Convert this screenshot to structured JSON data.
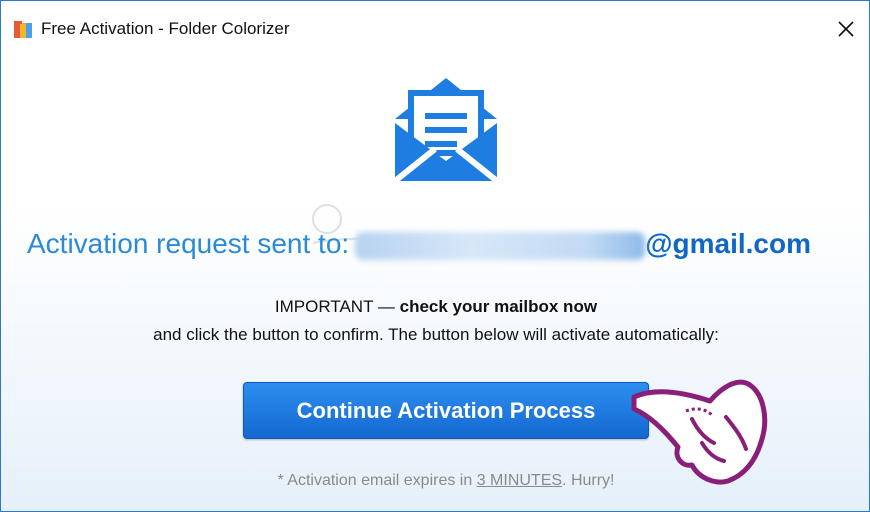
{
  "window": {
    "title": "Free Activation - Folder Colorizer",
    "close_icon": "close-icon"
  },
  "main": {
    "envelope_icon": "envelope-open-icon",
    "headline_prefix": "Activation request sent to:",
    "headline_domain": "@gmail.com",
    "important_prefix": "IMPORTANT — ",
    "important_bold": "check your mailbox now",
    "instruction": "and click the button to confirm. The button below will activate automatically:",
    "button_label": "Continue Activation Process",
    "expiry_prefix": "* Activation email expires in ",
    "expiry_time": "3 MINUTES",
    "expiry_suffix": ". Hurry!"
  },
  "colors": {
    "accent": "#2b8ad8",
    "button": "#1a73e0",
    "envelope": "#1e7de0"
  }
}
